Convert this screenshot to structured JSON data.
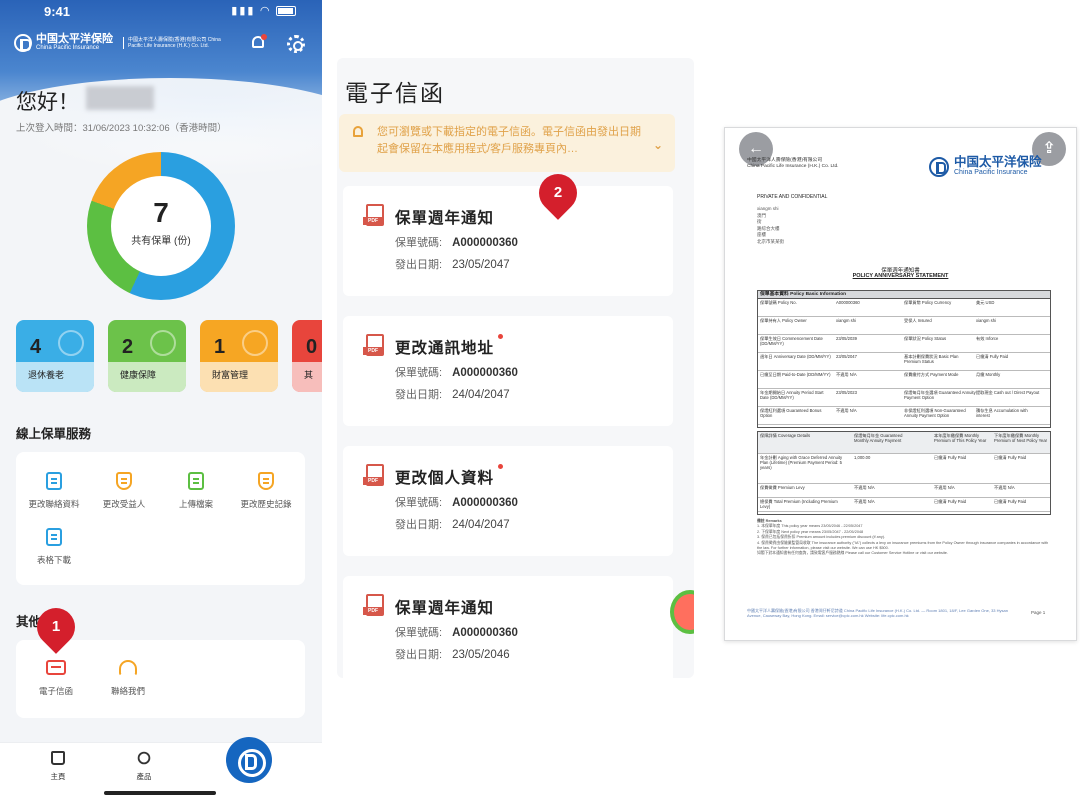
{
  "home": {
    "status_time": "9:41",
    "brand_cn": "中国太平洋保险",
    "brand_en": "China Pacific Insurance",
    "brand_sub": "中國太平洋人壽保險(香港)有限公司 China Pacific Life Insurance (H.K.) Co. Ltd.",
    "greeting": "您好！",
    "last_login": "上次登入時間：31/06/2023 10:32:06（香港時間）",
    "total_count": "7",
    "total_label": "共有保單 (份)",
    "donut_colors": {
      "blue": "#2a9fe0",
      "green": "#5cbf42",
      "orange": "#f5a524"
    },
    "categories": [
      {
        "count": "4",
        "label": "退休養老",
        "color": "#3aaee6",
        "icon": "umbrella-icon"
      },
      {
        "count": "2",
        "label": "健康保障",
        "color": "#6cc24a",
        "icon": "heart-icon"
      },
      {
        "count": "1",
        "label": "財富管理",
        "color": "#f6a623",
        "icon": "coin-icon"
      },
      {
        "count": "0",
        "label": "其",
        "color": "#e8453c",
        "icon": "shield-icon"
      }
    ],
    "services_title": "線上保單服務",
    "services": [
      {
        "label": "更改聯絡資料",
        "icon": "edit-doc-icon"
      },
      {
        "label": "更改受益人",
        "icon": "beneficiary-icon"
      },
      {
        "label": "上傳檔案",
        "icon": "upload-doc-icon"
      },
      {
        "label": "更改歷史記錄",
        "icon": "history-icon"
      },
      {
        "label": "表格下載",
        "icon": "form-download-icon"
      }
    ],
    "other_title": "其他服",
    "other": [
      {
        "label": "電子信函",
        "icon": "mail-icon"
      },
      {
        "label": "聯絡我們",
        "icon": "headset-icon"
      }
    ],
    "badge1": "1",
    "tabs": [
      {
        "label": "主頁",
        "icon": "home-icon"
      },
      {
        "label": "產品",
        "icon": "product-icon"
      }
    ]
  },
  "enotices": {
    "title": "電子信函",
    "notice": "您可瀏覽或下載指定的電子信函。電子信函由發出日期起會保留在本應用程式/客戶服務專頁內…",
    "badge2": "2",
    "number_label": "保單號碼:",
    "date_label": "發出日期:",
    "docs": [
      {
        "title": "保單週年通知",
        "number": "A000000360",
        "date": "23/05/2047",
        "unread": false
      },
      {
        "title": "更改通訊地址",
        "number": "A000000360",
        "date": "24/04/2047",
        "unread": true
      },
      {
        "title": "更改個人資料",
        "number": "A000000360",
        "date": "24/04/2047",
        "unread": true
      },
      {
        "title": "保單週年通知",
        "number": "A000000360",
        "date": "23/05/2046",
        "unread": false
      }
    ]
  },
  "statement": {
    "back_icon": "back-arrow-icon",
    "share_icon": "share-icon",
    "company_cn": "中國太平洋人壽保險(香港)有限公司",
    "company_en": "China Pacific Life Insurance (H.K.) Co. Ltd.",
    "logo_cn": "中国太平洋保险",
    "logo_en": "China Pacific Insurance",
    "private": "PRIVATE AND CONFIDENTIAL",
    "addressee": [
      "xiangm shi",
      "澳門",
      "街",
      "路綜合大樓",
      "座樓",
      "北京市某某街"
    ],
    "title_cn": "保單週年通知書",
    "title_en": "POLICY ANNIVERSARY STATEMENT",
    "basic_header": "保單基本資料 Policy Basic Information",
    "basic_rows": [
      [
        "保單號碼 Policy No.",
        "A000000360",
        "保單貨幣 Policy Currency",
        "美元 USD"
      ],
      [
        "保單持有人 Policy Owner",
        "xiangm shi",
        "受保人 Insured",
        "xiangm shi"
      ],
      [
        "保單生效日 Commencement Date (DD/MM/YY)",
        "23/05/2039",
        "保單狀況 Policy Status",
        "有效 Inforce"
      ],
      [
        "週年日 Anniversary Date (DD/MM/YY)",
        "23/05/2047",
        "基本計劃保費狀況 Basic Plan Premium Status",
        "已繳清 Fully Paid"
      ],
      [
        "已繳至日期 Paid-to-Date (DD/MM/YY)",
        "不適用 N/A",
        "保費繳付方式 Payment Mode",
        "月繳 Monthly"
      ],
      [
        "年金期開始日 Annuity Period Start Date (DD/MM/YY)",
        "23/05/2023",
        "保證每月年金選項 Guaranteed Annuity Payment Option",
        "提取現金 Cash out / Direct Payout"
      ],
      [
        "保證紅利選項 Guaranteed Bonus Option",
        "不適用 N/A",
        "非保證紅利選項 Non-Guaranteed Annuity Payment Option",
        "積存生息 Accumulation with interest"
      ]
    ],
    "coverage_headers": [
      "保障詳情 Coverage Details",
      "保證每月年金 Guaranteed Monthly Annuity Payment",
      "本年度年繳保費 Monthly Premium of This Policy Year",
      "下年度年繳保費 Monthly Premium of Next Policy Year"
    ],
    "coverage_rows": [
      [
        "年金計劃 Aging with Grace Deferred Annuity Plan (Lifetime) (Premium Payment Period: 5 years)",
        "1,000.00",
        "已繳清 Fully Paid",
        "已繳清 Fully Paid"
      ],
      [
        "保費徵費 Premium Levy",
        "不適用 N/A",
        "不適用 N/A",
        "不適用 N/A"
      ],
      [
        "總保費 Total Premium (Including Premium Levy)",
        "不適用 N/A",
        "已繳清 Fully Paid",
        "已繳清 Fully Paid"
      ]
    ],
    "remarks_title": "備註 Remarks",
    "remarks": [
      "1. 本保單年度 This policy year means 23/05/2046 - 22/05/2047",
      "2. 下保單年度 Next policy year means 23/05/2047 - 22/05/2048",
      "3. 保費已包括保費折扣 Premium amount includes premium discount (if any).",
      "4. 保費徵費由保險業監管局收取 The insurance authority (\"IA\") collects a levy on insurance premiums from the Policy Owner through insurance companies in accordance with the law. For further information, please visit our website. We can use HK $500.",
      "如閣下對本通知書有任何查詢，請致電客戶服務熱線 Please call our Customer Service Hotline or visit our website."
    ],
    "footer": "中國太平洋人壽保險(香港)有限公司 香港灣仔軒尼詩道 China Pacific Life Insurance (H.K.) Co. Ltd. — Room 1801, 18/F, Lee Garden One, 33 Hysan Avenue, Causeway Bay, Hong Kong. Email: service@cpic.com.hk  Website: life.cpic.com.hk",
    "page": "Page 1"
  }
}
